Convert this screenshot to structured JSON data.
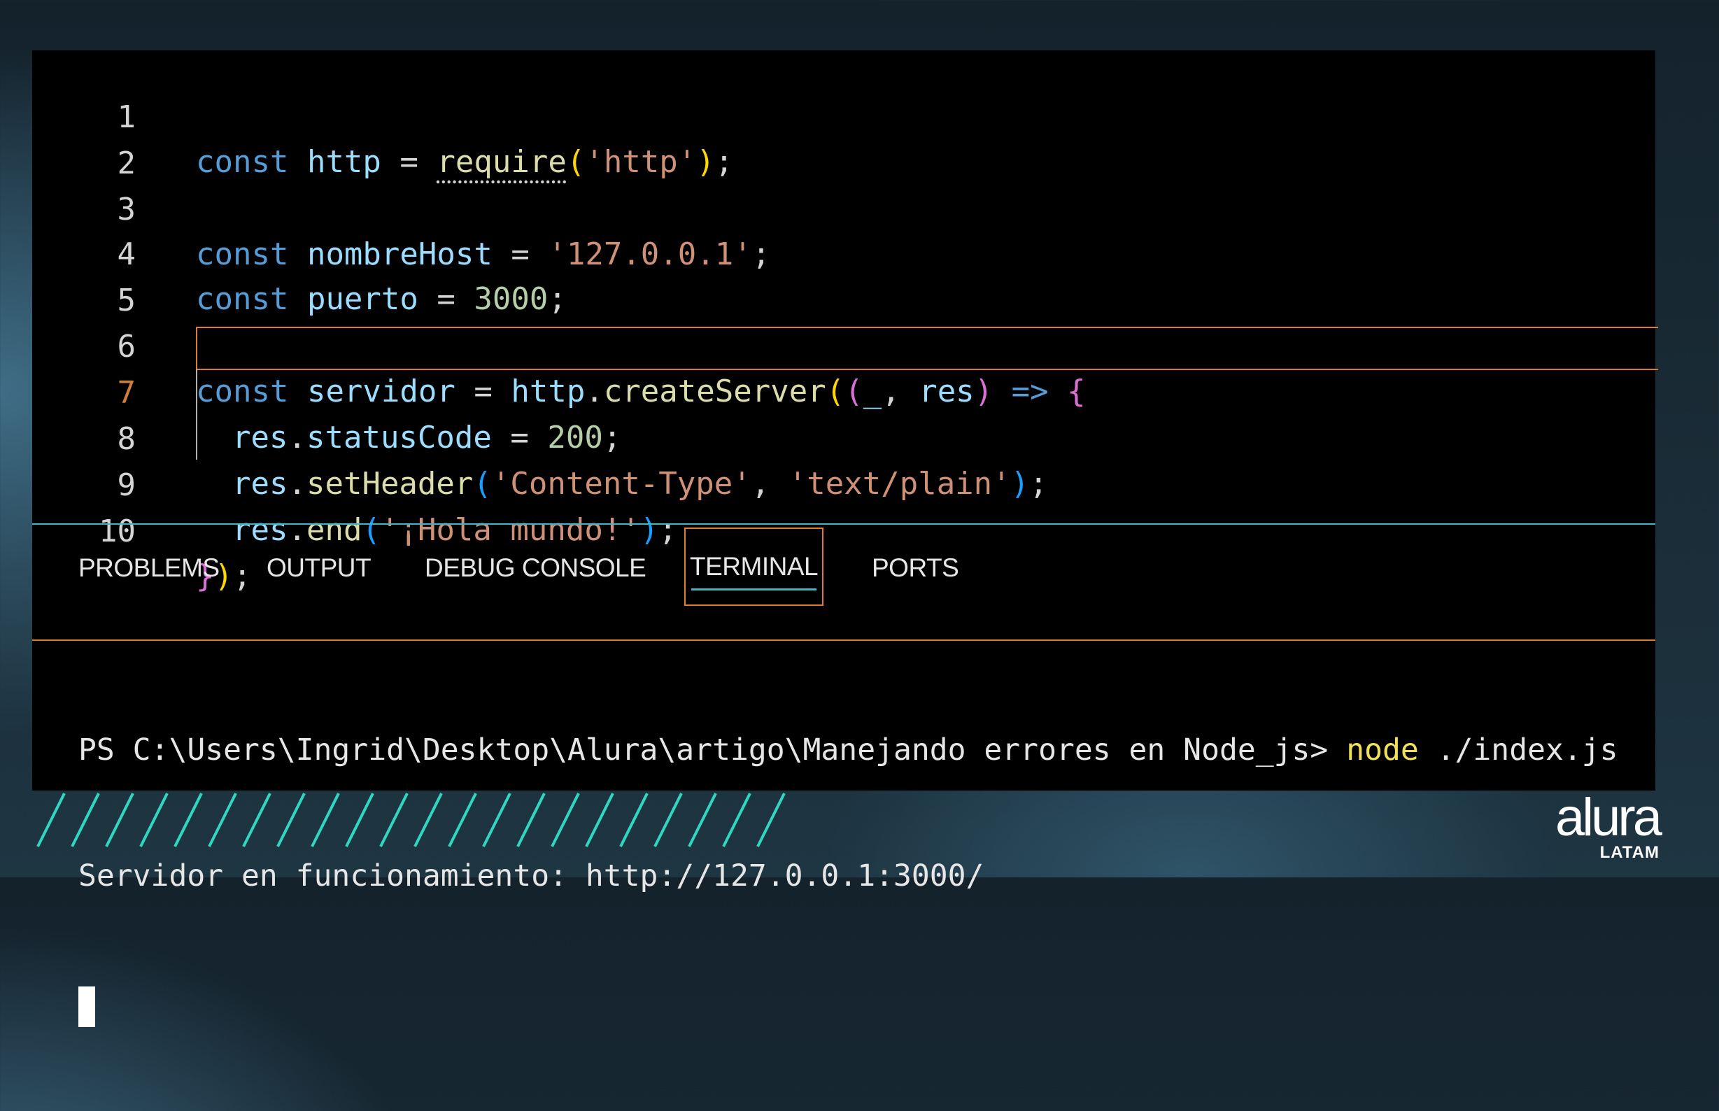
{
  "editor": {
    "lines": [
      {
        "number": "1"
      },
      {
        "number": "2"
      },
      {
        "number": "3"
      },
      {
        "number": "4"
      },
      {
        "number": "5"
      },
      {
        "number": "6"
      },
      {
        "number": "7"
      },
      {
        "number": "8"
      },
      {
        "number": "9"
      },
      {
        "number": "10"
      }
    ],
    "tokens": {
      "l1_kw": "const",
      "l1_var": "http",
      "l1_eq": " = ",
      "l1_fn": "require",
      "l1_open": "(",
      "l1_str": "'http'",
      "l1_close": ")",
      "l1_end": ";",
      "l3_kw": "const",
      "l3_var": "nombreHost",
      "l3_eq": " = ",
      "l3_str": "'127.0.0.1'",
      "l3_end": ";",
      "l4_kw": "const",
      "l4_var": "puerto",
      "l4_eq": " = ",
      "l4_num": "3000",
      "l4_end": ";",
      "l6_kw": "const",
      "l6_var": "servidor",
      "l6_eq": " = ",
      "l6_obj": "http",
      "l6_dot": ".",
      "l6_fn": "createServer",
      "l6_p1": "(",
      "l6_p2": "(",
      "l6_param1": "_",
      "l6_comma": ", ",
      "l6_param2": "res",
      "l6_p2c": ")",
      "l6_arrow": " => ",
      "l6_brace": "{",
      "l7_obj": "res",
      "l7_dot": ".",
      "l7_prop": "statusCode",
      "l7_eq": " = ",
      "l7_num": "200",
      "l7_end": ";",
      "l8_obj": "res",
      "l8_dot": ".",
      "l8_fn": "setHeader",
      "l8_open": "(",
      "l8_str1": "'Content-Type'",
      "l8_comma": ", ",
      "l8_str2": "'text/plain'",
      "l8_close": ")",
      "l8_end": ";",
      "l9_obj": "res",
      "l9_dot": ".",
      "l9_fn": "end",
      "l9_open": "(",
      "l9_str": "'¡Hola mundo!'",
      "l9_close": ")",
      "l9_end": ";",
      "l10_brace": "}",
      "l10_paren": ")",
      "l10_end": ";"
    }
  },
  "panel": {
    "tabs": [
      {
        "label": "PROBLEMS"
      },
      {
        "label": "OUTPUT"
      },
      {
        "label": "DEBUG CONSOLE"
      },
      {
        "label": "TERMINAL",
        "active": true
      },
      {
        "label": "PORTS"
      }
    ]
  },
  "terminal": {
    "prompt": "PS C:\\Users\\Ingrid\\Desktop\\Alura\\artigo\\Manejando errores en Node_js> ",
    "command": "node",
    "args": " ./index.js",
    "output": "Servidor en funcionamiento: http://127.0.0.1:3000/"
  },
  "branding": {
    "logo_text": "alura",
    "logo_region": "LATAM"
  },
  "colors": {
    "accent_orange": "#e07b2e",
    "accent_teal": "#3fb6c6",
    "stripe_color": "#2fd6c0"
  }
}
